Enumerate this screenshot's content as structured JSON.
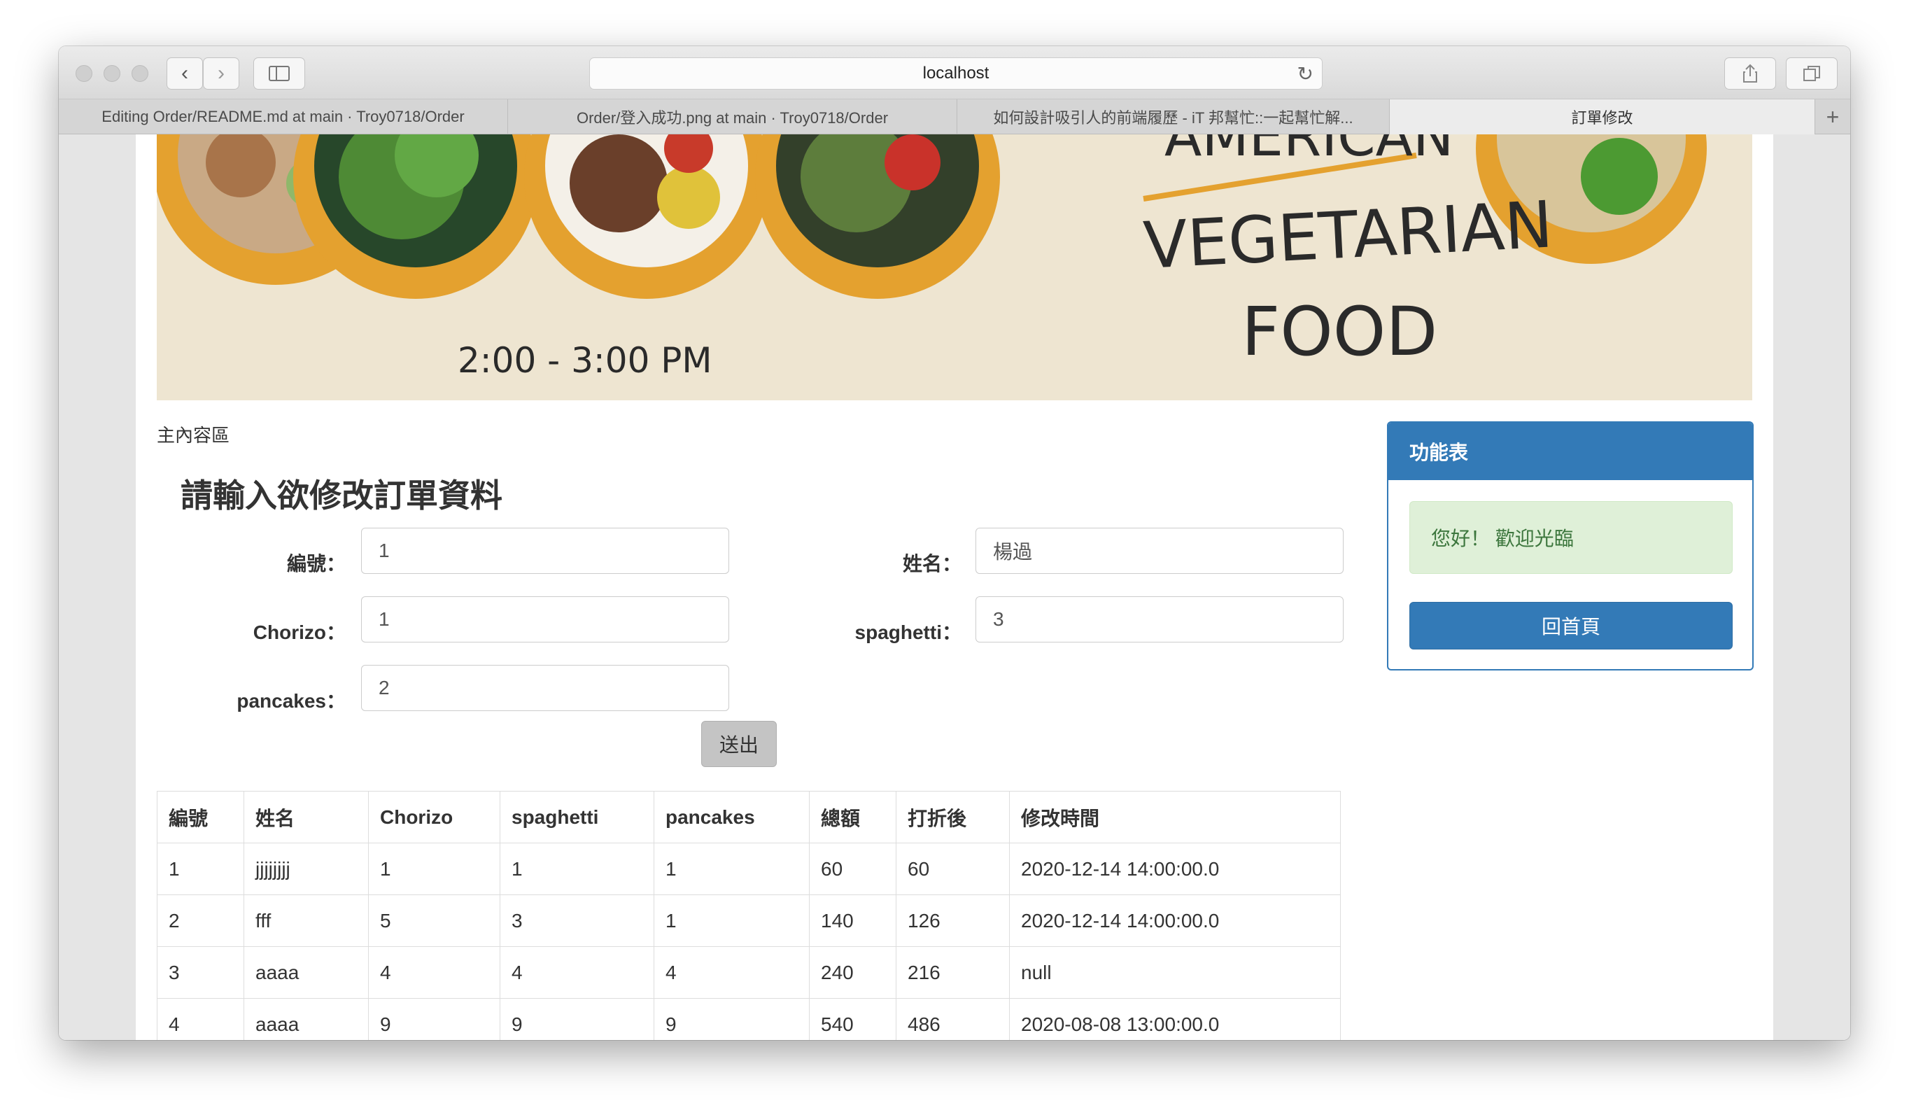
{
  "browser": {
    "url": "localhost",
    "tabs": [
      {
        "label": "Editing Order/README.md at main · Troy0718/Order"
      },
      {
        "label": "Order/登入成功.png at main · Troy0718/Order"
      },
      {
        "label": "如何設計吸引人的前端履歷 - iT 邦幫忙::一起幫忙解..."
      },
      {
        "label": "訂單修改"
      }
    ]
  },
  "banner": {
    "time_text": "2:00 - 3:00 PM",
    "line1": "AMERICAN",
    "line2": "VEGETARIAN",
    "line3": "FOOD"
  },
  "main": {
    "area_label": "主內容區",
    "heading": "請輸入欲修改訂單資料",
    "form": {
      "id_label": "編號：",
      "id_value": "1",
      "name_label": "姓名：",
      "name_value": "楊過",
      "chorizo_label": "Chorizo：",
      "chorizo_value": "1",
      "spaghetti_label": "spaghetti：",
      "spaghetti_value": "3",
      "pancakes_label": "pancakes：",
      "pancakes_value": "2",
      "submit_label": "送出"
    },
    "table": {
      "headers": [
        "編號",
        "姓名",
        "Chorizo",
        "spaghetti",
        "pancakes",
        "總額",
        "打折後",
        "修改時間"
      ],
      "rows": [
        [
          "1",
          "jjjjjjjj",
          "1",
          "1",
          "1",
          "60",
          "60",
          "2020-12-14 14:00:00.0"
        ],
        [
          "2",
          "fff",
          "5",
          "3",
          "1",
          "140",
          "126",
          "2020-12-14 14:00:00.0"
        ],
        [
          "3",
          "aaaa",
          "4",
          "4",
          "4",
          "240",
          "216",
          "null"
        ],
        [
          "4",
          "aaaa",
          "9",
          "9",
          "9",
          "540",
          "486",
          "2020-08-08 13:00:00.0"
        ]
      ]
    }
  },
  "sidebar": {
    "title": "功能表",
    "greeting": "您好！ 歡迎光臨",
    "home_button": "回首頁"
  },
  "colors": {
    "primary": "#337ab7",
    "success_bg": "#dff0d8",
    "success_text": "#3c763d",
    "banner_orange": "#e4a12f"
  }
}
